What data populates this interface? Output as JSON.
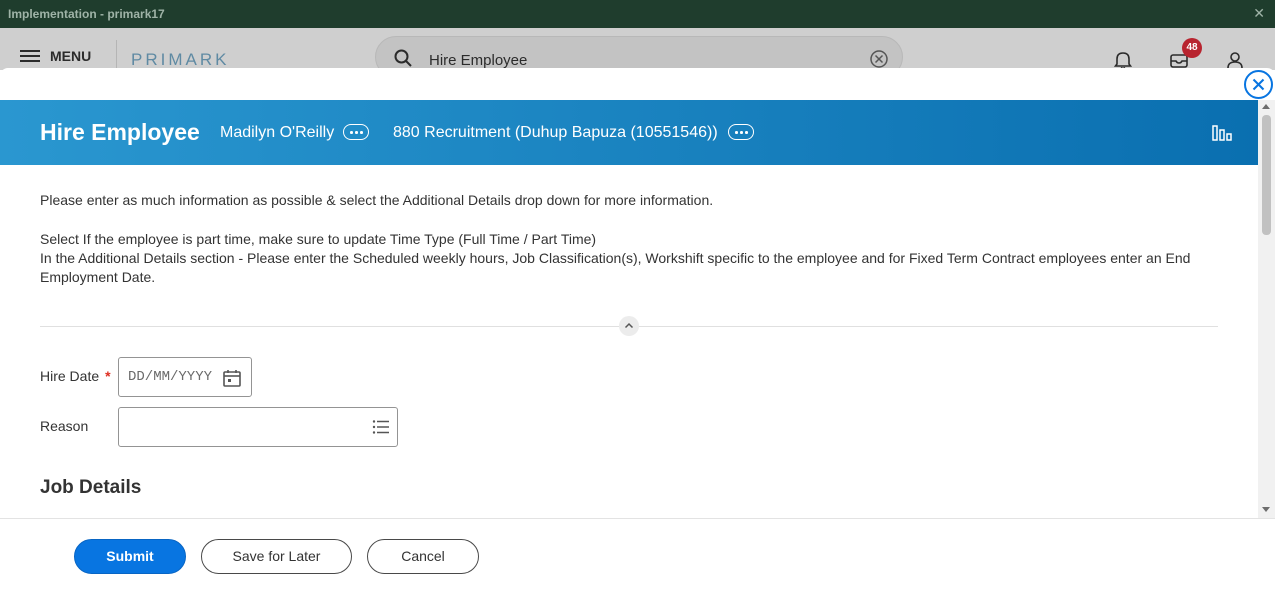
{
  "window": {
    "title": "Implementation - primark17",
    "close_symbol": "✕"
  },
  "header": {
    "menu_label": "MENU",
    "logo": "PRIMARK",
    "search": {
      "value": "Hire Employee"
    },
    "inbox_count": "48"
  },
  "task": {
    "title": "Hire Employee",
    "candidate": "Madilyn O'Reilly",
    "recruitment": "880 Recruitment (Duhup Bapuza (10551546))"
  },
  "instructions": {
    "line1": "Please enter as much information as possible & select the Additional Details drop down for more information.",
    "line2": "Select If the employee is part time, make sure to update Time Type (Full Time / Part Time)",
    "line3": "In the Additional Details section - Please enter the Scheduled weekly hours, Job Classification(s), Workshift specific to the employee and for Fixed Term Contract employees enter an End Employment Date."
  },
  "form": {
    "hire_date_label": "Hire Date",
    "required_mark": "*",
    "hire_date_placeholder": "DD/MM/YYYY",
    "reason_label": "Reason",
    "reason_value": "",
    "section_title": "Job Details"
  },
  "footer": {
    "submit": "Submit",
    "save_later": "Save for Later",
    "cancel": "Cancel"
  },
  "colors": {
    "primary": "#0875e1",
    "header_gradient_start": "#2a97d0",
    "header_gradient_end": "#0a6fb0",
    "badge": "#b8242f",
    "window_bar": "#1f3d2d"
  },
  "icons": [
    "hamburger-icon",
    "search-icon",
    "clear-search-icon",
    "bell-icon",
    "inbox-icon",
    "profile-icon",
    "close-icon",
    "related-actions-icon",
    "chart-icon",
    "chevron-up-icon",
    "calendar-icon",
    "prompt-list-icon"
  ]
}
